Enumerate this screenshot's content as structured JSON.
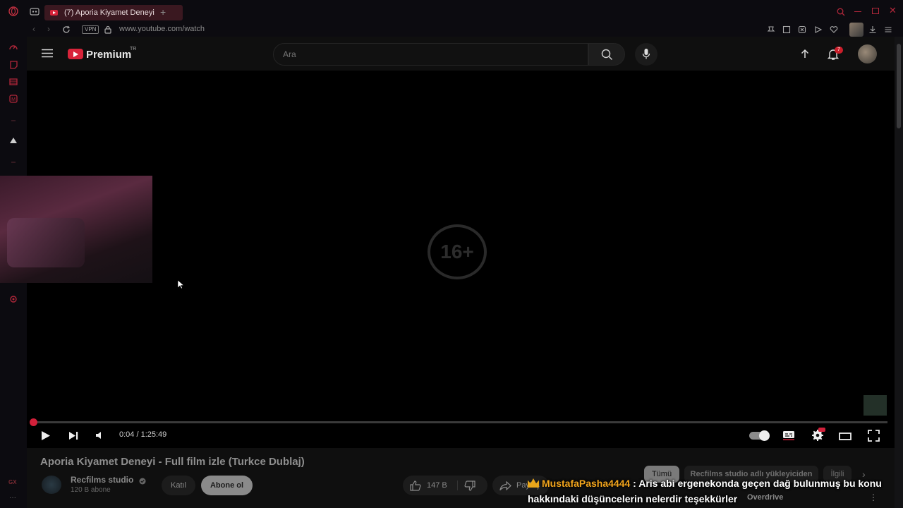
{
  "browser": {
    "tab_title": "(7) Aporia Kiyamet Deneyi",
    "url": "www.youtube.com/watch",
    "vpn_label": "VPN",
    "gx_label": "GX"
  },
  "youtube": {
    "logo_text": "Premium",
    "logo_region": "TR",
    "search_placeholder": "Ara",
    "notification_count": "7"
  },
  "player": {
    "rating_badge": "16+",
    "time_display": "0:04 / 1:25:49",
    "progress_fraction": 0.0008
  },
  "video_info": {
    "title": "Aporia Kiyamet Deneyi - Full film izle (Turkce Dublaj)",
    "channel_name": "Recfilms studio",
    "subscriber_count": "120 B abone",
    "join_label": "Katıl",
    "subscribe_label": "Abone ol",
    "like_count": "147 B",
    "share_label": "Paylaş"
  },
  "recommendation_chips": [
    "Tümü",
    "Recfilms studio adlı yükleyiciden",
    "İlgili"
  ],
  "sidebar_item": "Overdrive",
  "chat_overlay": {
    "username": "MustafaPasha4444",
    "separator": " : ",
    "message": "Aris abi ergenekonda geçen dağ bulunmuş bu konu hakkındaki düşüncelerin nelerdir teşekkürler"
  },
  "colors": {
    "accent": "#d2203a",
    "username": "#f2a51d"
  }
}
